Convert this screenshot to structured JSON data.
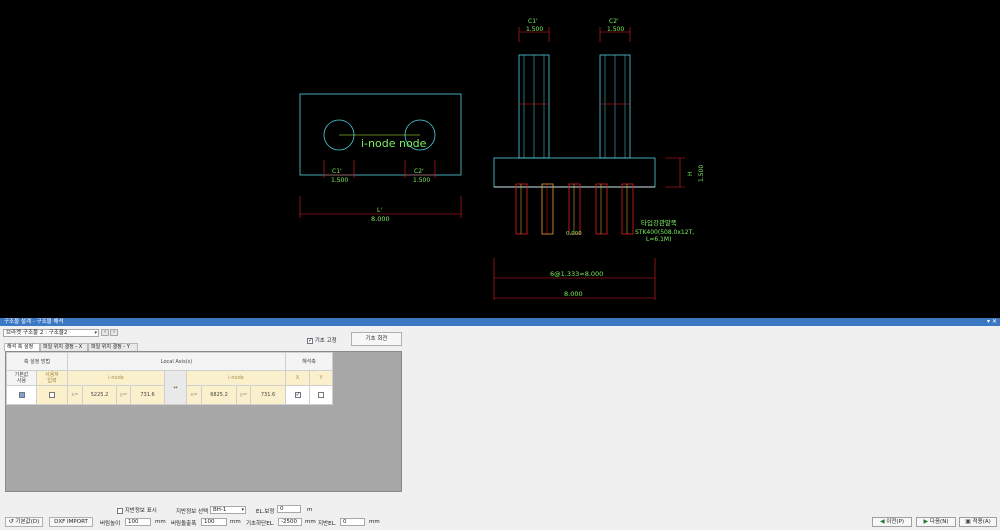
{
  "drawing": {
    "plan_column_left": "C1'",
    "plan_column_right": "C2'",
    "plan_dim_c1": "1.500",
    "plan_dim_c2": "1.500",
    "plan_width_label": "L'",
    "plan_width": "8.000",
    "plan_node_label": "i-node node",
    "elev_c1": "C1'",
    "elev_c1_dim": "1.500",
    "elev_c2": "C2'",
    "elev_c2_dim": "1.500",
    "elev_height_label": "H",
    "elev_height": "1.500",
    "pile_label": "타입강관말뚝",
    "pile_spec1": "STK400(508.0x12T,",
    "pile_spec2": "L=6.1M)",
    "pile_small": "0.000",
    "spacing_dim": "6@1.333=8.000",
    "total_dim": "8.000"
  },
  "panel": {
    "title": "구조물 설계 - 구조물 해석",
    "pin": "▾ ✕",
    "select_value": "브라켓 구조물 2 : 구조물2",
    "fix_base_label": "기초 고정",
    "fix_base_checked": true,
    "rotate_button": "기초 회전",
    "tabs": [
      "해석 축 설정",
      "파일 위치 결정 - X",
      "파일 위치 결정 - Y"
    ],
    "grid": {
      "col_axis_method": "축 설정 방법",
      "col_local_axis": "Local Axis(s)",
      "col_analysis_axis": "해석축",
      "default_use": "기본값\n사용",
      "user_input": "사용자\n입력",
      "i_node": "i-node",
      "j_node": "i-node",
      "swap": "↔",
      "x_axis": "X",
      "y_axis": "Y",
      "x_prefix": "x=",
      "y_prefix": "y=",
      "i_x": "5225.2",
      "i_y": "731.6",
      "j_x": "6825.2",
      "j_y": "731.6",
      "x_checked": true,
      "y_checked": false
    }
  },
  "bottom": {
    "show_ground_label": "지반정보 표시",
    "ground_select_label": "지반정보 선택",
    "ground_select_value": "BH-1",
    "el_correction_label": "EL.보정",
    "el_correction_value": "0",
    "el_unit": "m",
    "default_button": "기본값(D)",
    "dxf_button": "DXF IMPORT",
    "bracket_height_label": "버림높이",
    "bracket_height_value": "100",
    "bracket_height_unit": "mm",
    "bracket_width_label": "버림돌출폭",
    "bracket_width_value": "100",
    "bracket_width_unit": "mm",
    "base_bottom_el_label": "기초하단EL.",
    "base_bottom_el_value": "-2500",
    "base_bottom_el_unit": "mm",
    "ground_el_label": "지반EL.",
    "ground_el_value": "0",
    "ground_el_unit": "mm",
    "prev_button": "이전(P)",
    "next_button": "다음(N)",
    "apply_button": "적용(A)"
  }
}
